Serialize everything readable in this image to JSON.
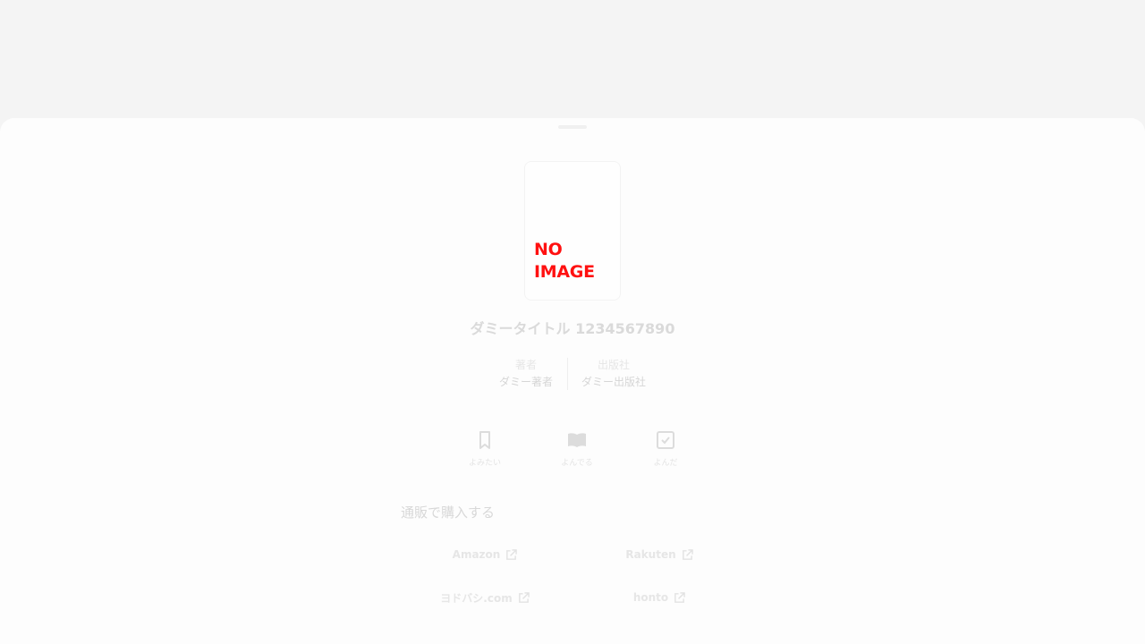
{
  "book": {
    "cover_text": "NO\nIMAGE",
    "title": "ダミータイトル 1234567890",
    "author_label": "著者",
    "author": "ダミー著者",
    "publisher_label": "出版社",
    "publisher": "ダミー出版社"
  },
  "status_buttons": [
    {
      "label": "よみたい",
      "icon": "bookmark-icon"
    },
    {
      "label": "よんでる",
      "icon": "open-book-icon"
    },
    {
      "label": "よんだ",
      "icon": "checkbox-icon"
    }
  ],
  "purchase": {
    "section_title": "通販で購入する",
    "shops": [
      {
        "label": "Amazon",
        "icon": "external-link-icon"
      },
      {
        "label": "Rakuten",
        "icon": "external-link-icon"
      },
      {
        "label": "ヨドバシ.com",
        "icon": "external-link-icon"
      },
      {
        "label": "honto",
        "icon": "external-link-icon"
      }
    ]
  },
  "colors": {
    "background": "#f4f4f4",
    "sheet": "#fdfdfd",
    "no_image_red": "#ff1010"
  }
}
